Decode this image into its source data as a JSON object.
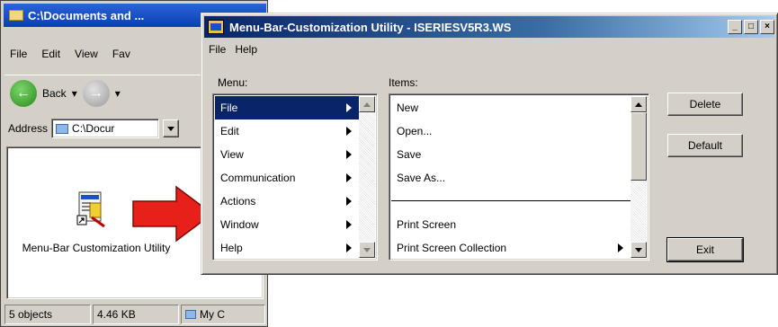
{
  "explorer": {
    "title": "C:\\Documents and ...",
    "menu": [
      "File",
      "Edit",
      "View",
      "Fav"
    ],
    "back_label": "Back",
    "address_label": "Address",
    "address_value": "C:\\Docur",
    "file_label": "Menu-Bar Customization Utility",
    "status": [
      "5 objects",
      "4.46 KB",
      "My C"
    ]
  },
  "dialog": {
    "title": "Menu-Bar-Customization Utility - ISERIESV5R3.WS",
    "menu": [
      "File",
      "Help"
    ],
    "menu_group_label": "Menu:",
    "items_group_label": "Items:",
    "menus": [
      {
        "label": "File",
        "selected": true
      },
      {
        "label": "Edit",
        "selected": false
      },
      {
        "label": "View",
        "selected": false
      },
      {
        "label": "Communication",
        "selected": false
      },
      {
        "label": "Actions",
        "selected": false
      },
      {
        "label": "Window",
        "selected": false
      },
      {
        "label": "Help",
        "selected": false
      }
    ],
    "items": [
      {
        "label": "New",
        "type": "item"
      },
      {
        "label": "Open...",
        "type": "item"
      },
      {
        "label": "Save",
        "type": "item"
      },
      {
        "label": "Save As...",
        "type": "item"
      },
      {
        "label": "",
        "type": "separator"
      },
      {
        "label": "Print Screen",
        "type": "item"
      },
      {
        "label": "Print Screen Collection",
        "type": "submenu"
      }
    ],
    "buttons": {
      "delete": "Delete",
      "default": "Default",
      "exit": "Exit"
    },
    "window_buttons": {
      "minimize": "_",
      "maximize": "□",
      "close": "×"
    }
  },
  "colors": {
    "selection": "#0a246a",
    "arrow": "#e8201a",
    "face": "#d4d0c8"
  }
}
